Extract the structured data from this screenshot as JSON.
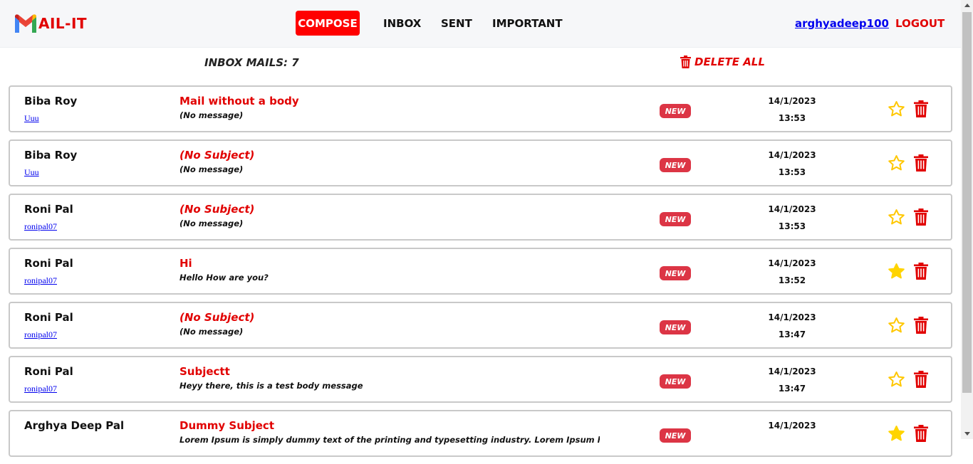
{
  "brand": {
    "text": "AIL-IT",
    "logo_icon": "gmail-m-icon"
  },
  "nav": {
    "compose": "COMPOSE",
    "inbox": "INBOX",
    "sent": "SENT",
    "important": "IMPORTANT",
    "user": "arghyadeep100",
    "logout": "LOGOUT"
  },
  "toolbar": {
    "inbox_count": "INBOX MAILS: 7",
    "delete_all": "DELETE ALL"
  },
  "colors": {
    "accent": "#ff0000",
    "badge": "#dc3545",
    "star": "#ffd400",
    "link": "#0000ee"
  },
  "mails": [
    {
      "sender": "Biba Roy",
      "sender_id": "Uuu",
      "subject": "Mail without a body",
      "body": "(No message)",
      "badge": "NEW",
      "date": "14/1/2023",
      "time": "13:53",
      "starred": false
    },
    {
      "sender": "Biba Roy",
      "sender_id": "Uuu",
      "subject": "(No Subject)",
      "body": "(No message)",
      "badge": "NEW",
      "date": "14/1/2023",
      "time": "13:53",
      "starred": false
    },
    {
      "sender": "Roni Pal",
      "sender_id": "ronipal07",
      "subject": "(No Subject)",
      "body": "(No message)",
      "badge": "NEW",
      "date": "14/1/2023",
      "time": "13:53",
      "starred": false
    },
    {
      "sender": "Roni Pal",
      "sender_id": "ronipal07",
      "subject": "Hi",
      "body": "Hello How are you?",
      "badge": "NEW",
      "date": "14/1/2023",
      "time": "13:52",
      "starred": true
    },
    {
      "sender": "Roni Pal",
      "sender_id": "ronipal07",
      "subject": "(No Subject)",
      "body": "(No message)",
      "badge": "NEW",
      "date": "14/1/2023",
      "time": "13:47",
      "starred": false
    },
    {
      "sender": "Roni Pal",
      "sender_id": "ronipal07",
      "subject": "Subjectt",
      "body": "Heyy there, this is a test body message",
      "badge": "NEW",
      "date": "14/1/2023",
      "time": "13:47",
      "starred": false
    },
    {
      "sender": "Arghya Deep Pal",
      "sender_id": "",
      "subject": "Dummy Subject",
      "body": "Lorem Ipsum is simply dummy text of the printing and typesetting industry. Lorem Ipsum has been the",
      "badge": "NEW",
      "date": "14/1/2023",
      "time": "",
      "starred": true
    }
  ]
}
